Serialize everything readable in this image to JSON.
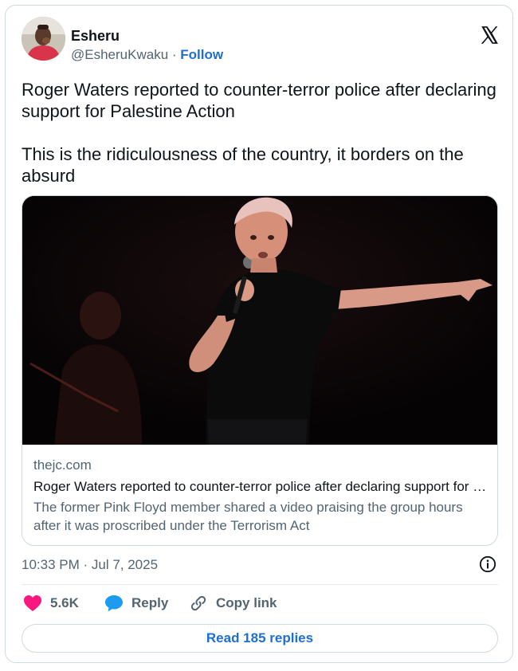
{
  "author": {
    "display_name": "Esheru",
    "handle": "@EsheruKwaku",
    "separator": " · ",
    "follow_label": "Follow"
  },
  "platform_icon": "x-logo-icon",
  "tweet": {
    "text_line1": "Roger Waters reported to counter-terror police after declaring support for Palestine Action",
    "text_line2": "This is the ridiculousness of the country, it borders on the absurd"
  },
  "link_card": {
    "domain": "thejc.com",
    "title": "Roger Waters reported to counter-terror police after declaring support for Palestine Action",
    "description": "The former Pink Floyd member shared a video praising the group hours after it was proscribed under the Terrorism Act"
  },
  "timestamp": "10:33 PM · Jul 7, 2025",
  "actions": {
    "like_count": "5.6K",
    "reply_label": "Reply",
    "copy_link_label": "Copy link"
  },
  "read_replies_label": "Read 185 replies",
  "colors": {
    "accent": "#1d6fd1",
    "like": "#f91880",
    "reply_icon": "#1d9bf0",
    "text": "#0f1419",
    "secondary": "#536471",
    "border": "#cfd9de"
  }
}
